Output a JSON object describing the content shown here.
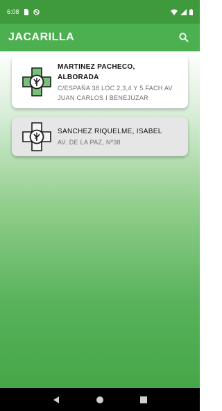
{
  "status": {
    "time": "6:08",
    "icons": [
      "sim-icon",
      "no-disturb-icon",
      "wifi-icon",
      "signal-icon",
      "battery-icon"
    ]
  },
  "app_bar": {
    "title": "JACARILLA",
    "search_icon": "search-icon"
  },
  "pharmacies": [
    {
      "name_line1": "MARTINEZ PACHECO,",
      "name_line2": "ALBORADA",
      "addr_line1": "C/ESPAÑA 38 LOC 2,3,4 Y 5 FACH AV",
      "addr_line2": "JUAN CARLOS I BENEJÚZAR",
      "icon": "pharmacy-cross-green-icon"
    },
    {
      "name_line1": "SANCHEZ RIQUELME, ISABEL",
      "addr_line1": "AV. DE LA PAZ, Nº38",
      "icon": "pharmacy-cross-white-icon"
    }
  ],
  "colors": {
    "status_bar": "#3f9a3c",
    "app_bar": "#4caf50",
    "accent_green": "#6cc070"
  },
  "nav": {
    "back_icon": "back-icon",
    "home_icon": "home-icon",
    "recents_icon": "recents-icon"
  }
}
